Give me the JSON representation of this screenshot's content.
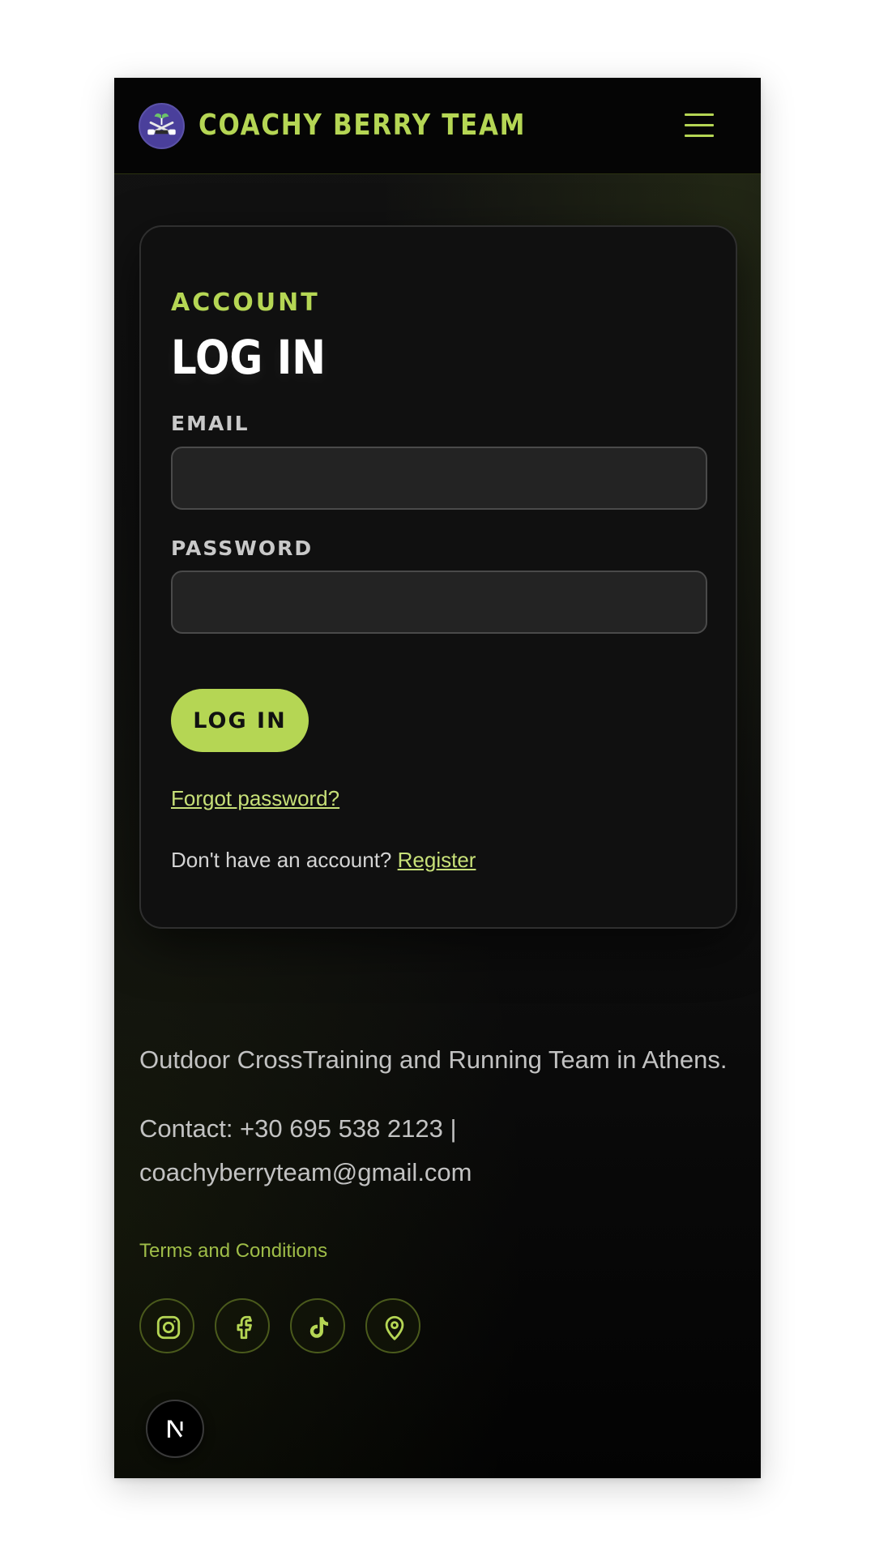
{
  "header": {
    "brand": "COACHY BERRY TEAM",
    "logo_icon": "team-logo-icon",
    "menu_icon": "hamburger-menu-icon"
  },
  "login": {
    "eyebrow": "ACCOUNT",
    "title": "LOG IN",
    "email_label": "EMAIL",
    "email_value": "",
    "password_label": "PASSWORD",
    "password_value": "",
    "submit_label": "LOG IN",
    "forgot_label": "Forgot password?",
    "no_account_text": "Don't have an account?",
    "register_label": "Register"
  },
  "footer": {
    "tagline": "Outdoor CrossTraining and Running Team in Athens.",
    "contact_line1": "Contact: +30 695 538 2123 |",
    "contact_line2": "coachyberryteam@gmail.com",
    "terms_label": "Terms and Conditions",
    "social_icons": [
      "instagram-icon",
      "facebook-icon",
      "tiktok-icon",
      "map-pin-icon"
    ]
  },
  "dev_badge": {
    "label": "N",
    "icon": "nextjs-icon"
  },
  "colors": {
    "accent": "#b5d654",
    "background": "#0f0f0f",
    "card": "#101010",
    "input": "#232323",
    "logo_bg": "#4a3f9b"
  }
}
